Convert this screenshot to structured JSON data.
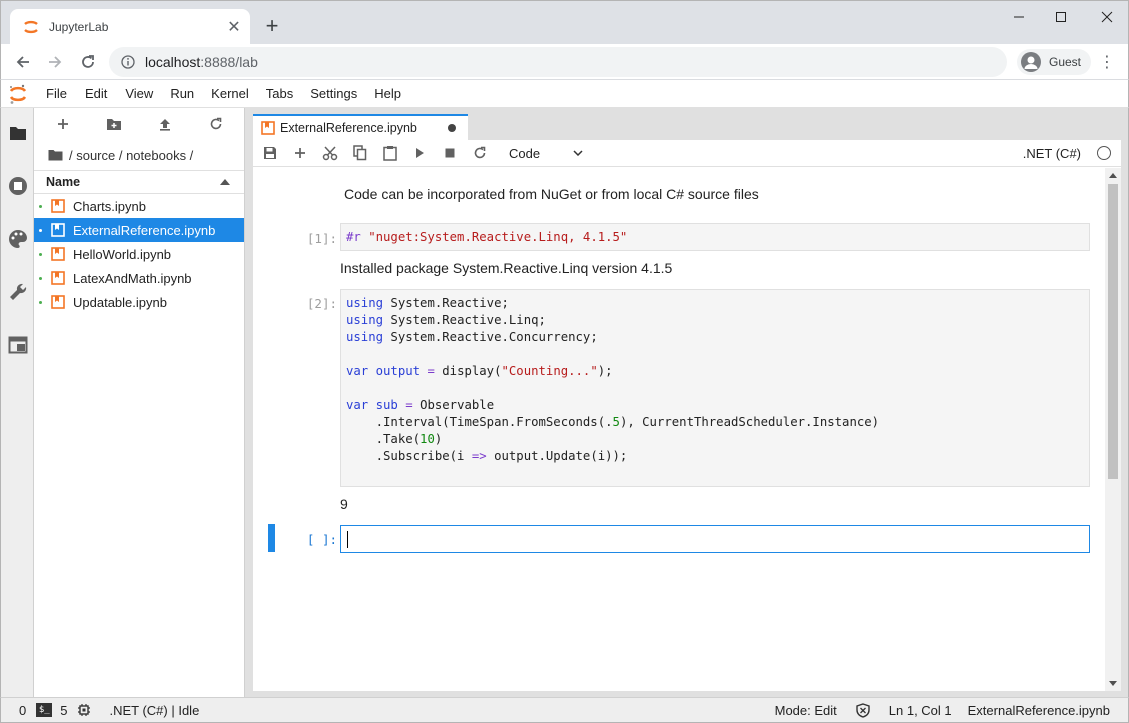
{
  "browser": {
    "tab_title": "JupyterLab",
    "close_glyph": "✕",
    "newtab_glyph": "+",
    "url_host": "localhost",
    "url_path": ":8888/lab",
    "profile_name": "Guest",
    "kebab_glyph": "⋮"
  },
  "menubar": {
    "items": [
      "File",
      "Edit",
      "View",
      "Run",
      "Kernel",
      "Tabs",
      "Settings",
      "Help"
    ]
  },
  "filebrowser": {
    "breadcrumb": "/ source / notebooks /",
    "header_name": "Name",
    "files": [
      "Charts.ipynb",
      "ExternalReference.ipynb",
      "HelloWorld.ipynb",
      "LatexAndMath.ipynb",
      "Updatable.ipynb"
    ],
    "selected_index": 1
  },
  "notebook": {
    "tab_title": "ExternalReference.ipynb",
    "cell_type": "Code",
    "kernel_name": ".NET (C#)",
    "markdown_text": "Code can be incorporated from NuGet or from local C# source files",
    "cell1_prompt": "[1]:",
    "cell1_code_kw": "#r ",
    "cell1_code_str": "\"nuget:System.Reactive.Linq, 4.1.5\"",
    "cell1_output": "Installed package System.Reactive.Linq version 4.1.5",
    "cell2_prompt": "[2]:",
    "cell2_output": "9",
    "cell3_prompt": "[ ]:"
  },
  "code2": {
    "using": "using",
    "ns1": " System.Reactive;",
    "ns2": " System.Reactive.Linq;",
    "ns3": " System.Reactive.Concurrency;",
    "var": "var",
    "output": " output",
    "eq": " = ",
    "display": "display(",
    "counting": "\"Counting...\"",
    "close": ");",
    "sub": " sub",
    "observable": "Observable",
    "interval": "    .Interval(TimeSpan.FromSeconds(.",
    "five": "5",
    "interval_end": "), CurrentThreadScheduler.Instance)",
    "take": "    .Take(",
    "ten": "10",
    "paren": ")",
    "subscribe1": "    .Subscribe(i ",
    "arrow": "=>",
    "subscribe2": " output.Update(i));"
  },
  "statusbar": {
    "left_count": "0",
    "term_label": "$_",
    "kernel_count": "5",
    "kernel_status": ".NET (C#) | Idle",
    "mode": "Mode: Edit",
    "position": "Ln 1, Col 1",
    "filename": "ExternalReference.ipynb"
  },
  "colors": {
    "accent": "#1e88e5",
    "jupyter_orange": "#f37626"
  }
}
